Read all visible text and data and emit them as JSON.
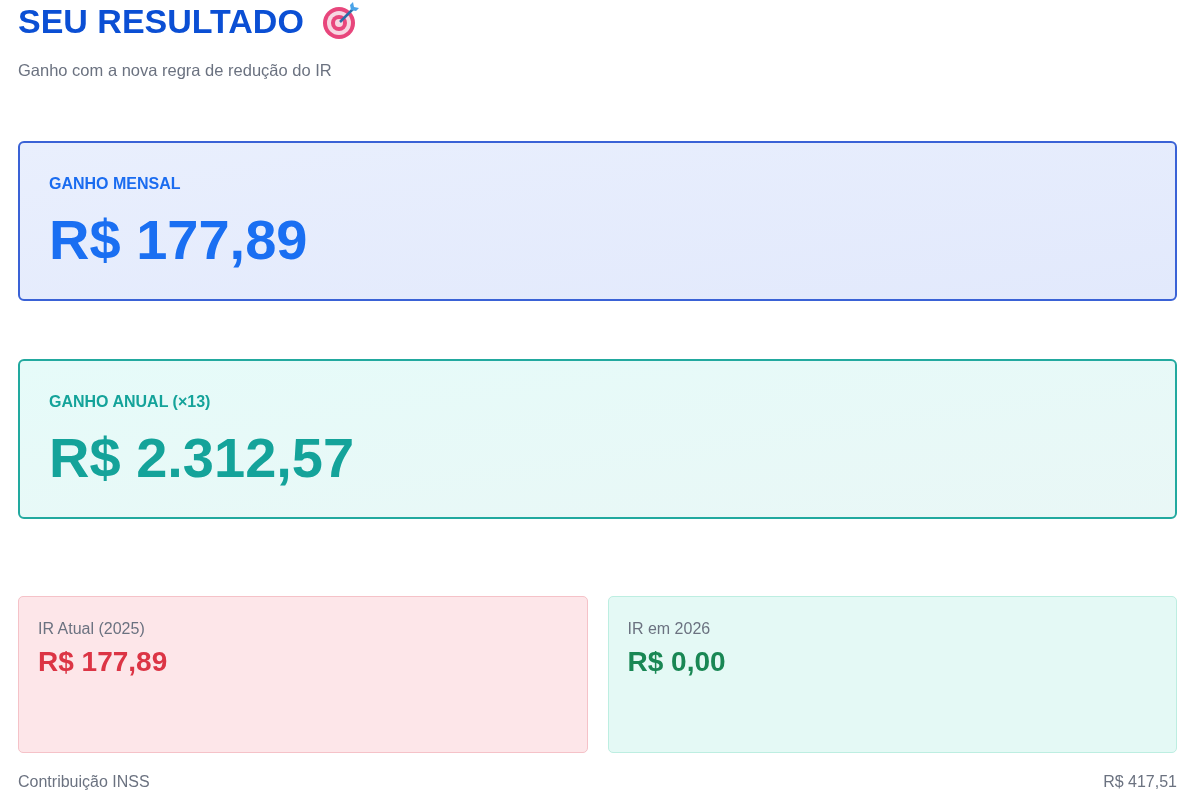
{
  "header": {
    "title": "SEU RESULTADO",
    "subtitle": "Ganho com a nova regra de redução do IR"
  },
  "highlights": [
    {
      "kind": "monthly",
      "label": "GANHO MENSAL",
      "value": "R$ 177,89"
    },
    {
      "kind": "annual",
      "label": "GANHO ANUAL (×13)",
      "value": "R$ 2.312,57"
    }
  ],
  "comparison": [
    {
      "kind": "current",
      "label": "IR Atual (2025)",
      "value": "R$ 177,89"
    },
    {
      "kind": "new",
      "label": "IR em 2026",
      "value": "R$ 0,00"
    }
  ],
  "details": [
    {
      "label": "Contribuição INSS",
      "value": "R$ 417,51"
    }
  ]
}
